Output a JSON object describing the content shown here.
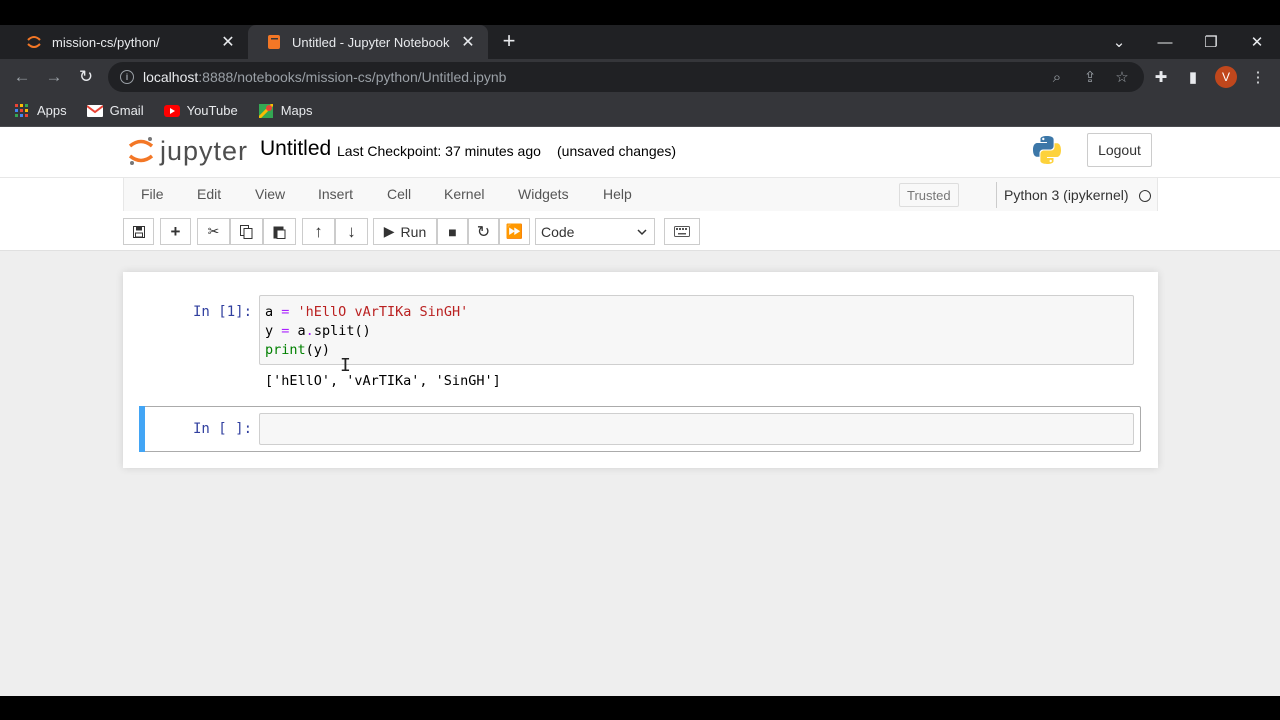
{
  "browser": {
    "tabs": [
      {
        "title": "mission-cs/python/",
        "active": false
      },
      {
        "title": "Untitled - Jupyter Notebook",
        "active": true
      }
    ],
    "url_host": "localhost",
    "url_path": ":8888/notebooks/mission-cs/python/Untitled.ipynb",
    "avatar_letter": "V",
    "bookmarks": [
      "Apps",
      "Gmail",
      "YouTube",
      "Maps"
    ]
  },
  "jupyter": {
    "logo_text": "jupyter",
    "notebook_name": "Untitled",
    "checkpoint": "Last Checkpoint: 37 minutes ago",
    "unsaved": "(unsaved changes)",
    "logout_label": "Logout",
    "menu": [
      "File",
      "Edit",
      "View",
      "Insert",
      "Cell",
      "Kernel",
      "Widgets",
      "Help"
    ],
    "trusted_label": "Trusted",
    "kernel_name": "Python 3 (ipykernel)",
    "run_label": "Run",
    "cell_type": "Code"
  },
  "cells": [
    {
      "prompt": "In [1]:",
      "lines": [
        "a = 'hEllO vArTIKa SinGH'",
        "y = a.split()",
        "print(y)"
      ],
      "output": "['hEllO', 'vArTIKa', 'SinGH']"
    },
    {
      "prompt": "In [ ]:",
      "lines": [],
      "output": ""
    }
  ],
  "colors": {
    "accent_selected_cell": "#42a5f5",
    "prompt_in": "#303f9f",
    "string": "#ba2121",
    "operator": "#aa22ff",
    "builtin": "#008000"
  }
}
